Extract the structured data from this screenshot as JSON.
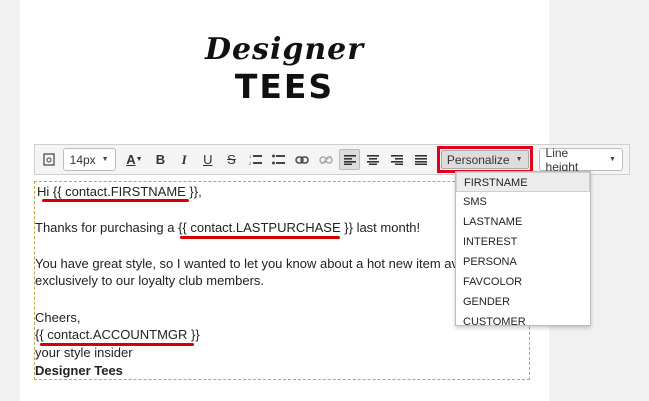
{
  "logo": {
    "line1": "Designer",
    "line2": "TEES"
  },
  "toolbar": {
    "font_size": "14px",
    "personalize_label": "Personalize",
    "line_height_label": "Line height"
  },
  "editor": {
    "greeting_prefix": "Hi ",
    "token_firstname": "{{ contact.FIRSTNAME }}",
    "greeting_suffix": ",",
    "thanks_prefix": "Thanks for purchasing a  ",
    "token_lastpurchase": "{{ contact.LASTPURCHASE }}",
    "thanks_suffix": " last month!",
    "body_line1": "You have great style, so I wanted to let you know about a hot new item avai",
    "body_line2": "exclusively to our loyalty club members.",
    "cheers": "Cheers,",
    "token_accountmgr": "{{ contact.ACCOUNTMGR }}",
    "sign_line": "your style insider",
    "company": "Designer Tees"
  },
  "personalize_menu": {
    "items": [
      "FIRSTNAME",
      "SMS",
      "LASTNAME",
      "INTEREST",
      "PERSONA",
      "FAVCOLOR",
      "GENDER",
      "CUSTOMER"
    ]
  },
  "colors": {
    "highlight_red": "#e0001b",
    "border_dashed": "#c9a24a"
  }
}
